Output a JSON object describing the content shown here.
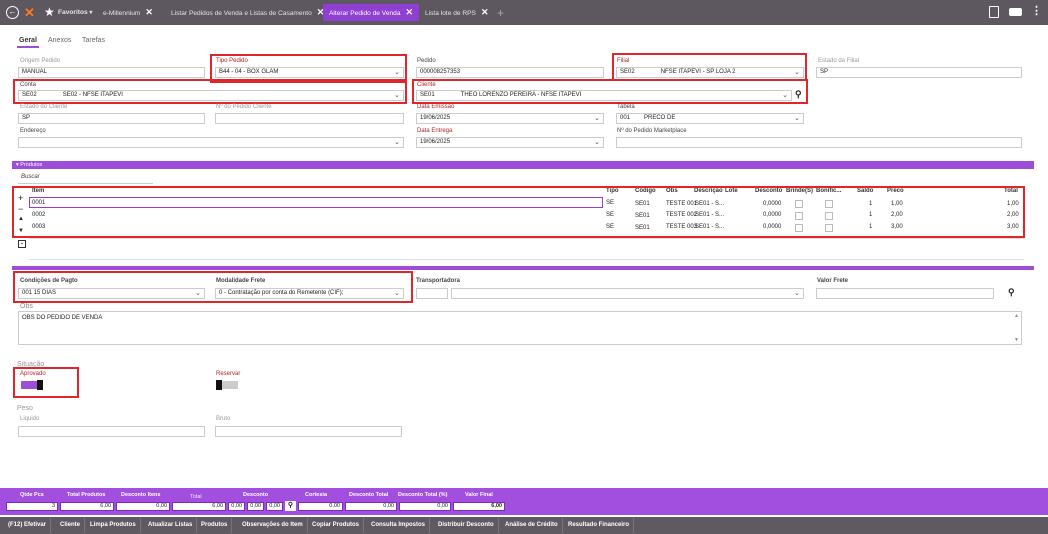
{
  "topbar": {
    "favoritos": "Favoritos",
    "tabs": [
      {
        "label": "e-Millennium"
      },
      {
        "label": "Listar Pedidos de Venda e Listas de Casamento"
      },
      {
        "label": "Alterar Pedido de Venda"
      },
      {
        "label": "Lista lote de RPS"
      }
    ]
  },
  "subtabs": [
    "Geral",
    "Anexos",
    "Tarefas"
  ],
  "form": {
    "origem_label": "Origem Pedido",
    "origem_value": "MANUAL",
    "tipo_label": "Tipo Pedido",
    "tipo_value": "B44 - 04 - BOX GLAM",
    "pedido_label": "Pedido",
    "pedido_value": "000008257353",
    "filial_label": "Filial",
    "filial_code": "SE02",
    "filial_value": "NFSE ITAPEVI - SP LOJA 2",
    "estado_filial_label": "Estado da Filial",
    "estado_filial_value": "SP",
    "conta_label": "Conta",
    "conta_code": "SE02",
    "conta_value": "SE02 - NFSE ITAPEVI",
    "cliente_label": "Cliente",
    "cliente_code": "SE01",
    "cliente_value": "THEO LORENZO PEREIRA - NFSE ITAPEVI",
    "estado_cliente_label": "Estado do Cliente",
    "estado_cliente_value": "SP",
    "nr_pedido_cliente_label": "Nº do Pedido Cliente",
    "data_emissao_label": "Data Emissão",
    "data_emissao_value": "19/06/2025",
    "tabela_label": "Tabela",
    "tabela_code": "001",
    "tabela_value": "PRECO DE",
    "endereco_label": "Endereço",
    "data_entrega_label": "Data Entrega",
    "data_entrega_value": "19/06/2025",
    "nr_marketplace_label": "Nº do Pedido Marketplace"
  },
  "produtos": {
    "band_label": "Produtos",
    "buscar": "Buscar",
    "headers": [
      "Item",
      "Tipo",
      "Código",
      "Obs",
      "Descrição",
      "Lote",
      "Desconto",
      "Brinde(S)",
      "Bonific...",
      "Saldo",
      "Preco",
      "Total"
    ],
    "rows": [
      {
        "item": "0001",
        "tipo": "SE",
        "codigo": "SE01",
        "obs": "TESTE 001",
        "descricao": "SE01 - S...",
        "desconto": "0,0000",
        "saldo": "1",
        "preco": "1,00",
        "total": "1,00"
      },
      {
        "item": "0002",
        "tipo": "SE",
        "codigo": "SE01",
        "obs": "TESTE 002",
        "descricao": "SE01 - S...",
        "desconto": "0,0000",
        "saldo": "1",
        "preco": "2,00",
        "total": "2,00"
      },
      {
        "item": "0003",
        "tipo": "SE",
        "codigo": "SE01",
        "obs": "TESTE 003",
        "descricao": "SE01 - S...",
        "desconto": "0,0000",
        "saldo": "1",
        "preco": "3,00",
        "total": "3,00"
      }
    ]
  },
  "pagto": {
    "cond_label": "Condições de Pagto",
    "cond_value": "001  15 DIAS",
    "frete_label": "Modalidade Frete",
    "frete_value": "0 - Contratação por conta do Remetente (CIF);",
    "transp_label": "Transportadora",
    "valor_frete_label": "Valor Frete",
    "obs_label": "Obs",
    "obs_value": "OBS DO PEDIDO DE VENDA"
  },
  "situacao": {
    "label": "Situação",
    "aprovado_label": "Aprovado",
    "aprovado_on": true,
    "reservar_label": "Reservar",
    "reservar_on": false
  },
  "peso": {
    "label": "Peso",
    "liquido_label": "Liquido",
    "bruto_label": "Bruto"
  },
  "totals": {
    "qtde_label": "Qtde Pcs",
    "qtde_value": "3",
    "total_produtos_label": "Total Produtos",
    "total_produtos_value": "6,00",
    "desc_itens_label": "Desconto Itens",
    "desc_itens_value": "0,00",
    "total_label": "Total",
    "total_value": "6,00",
    "desconto_label": "Desconto",
    "desconto_v1": "0,00",
    "desconto_v2": "0,00",
    "desconto_v3": "0,00",
    "cortesia_label": "Cortesia",
    "cortesia_value": "0,00",
    "desc_total_label": "Desconto Total",
    "desc_total_value": "0,00",
    "desc_total_pct_label": "Desconto Total (%)",
    "desc_total_pct_value": "0,00",
    "valor_final_label": "Valor Final",
    "valor_final_value": "6,00"
  },
  "actions": [
    "(F12) Efetivar",
    "Cliente",
    "Limpa Produtos",
    "Atualizar Listas",
    "Produtos",
    "Observações do Item",
    "Copiar Produtos",
    "Consulta Impostos",
    "Distribuir Desconto",
    "Análise de Crédito",
    "Resultado Financeiro"
  ],
  "colors": {
    "accent": "#9c4fd6",
    "topbar": "#5d5860",
    "highlight": "#e0262b"
  }
}
